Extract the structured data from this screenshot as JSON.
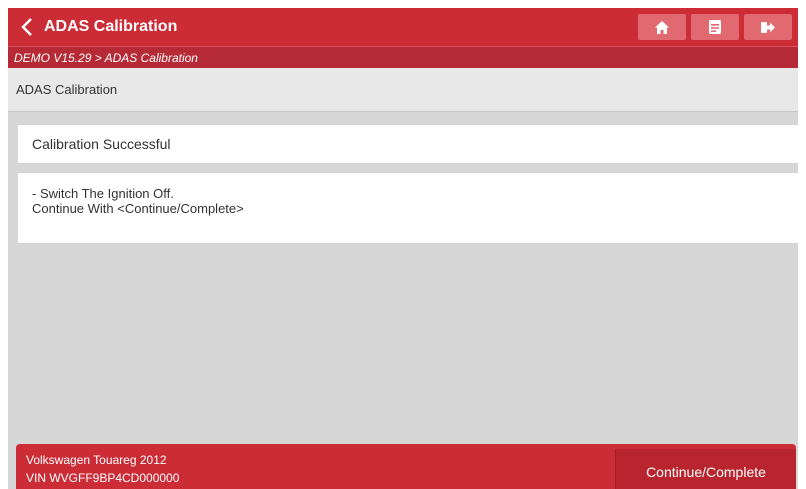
{
  "header": {
    "title": "ADAS Calibration",
    "buttons": [
      {
        "icon": "home-icon"
      },
      {
        "icon": "report-icon"
      },
      {
        "icon": "exit-icon"
      }
    ]
  },
  "breadcrumb": "DEMO V15.29 > ADAS Calibration",
  "subheader": "ADAS Calibration",
  "status": "Calibration Successful",
  "message": {
    "line1": "- Switch The Ignition Off.",
    "line2": "Continue With <Continue/Complete>"
  },
  "footer": {
    "vehicle": "Volkswagen Touareg 2012",
    "vin": "VIN WVGFF9BP4CD000000",
    "continue_label": "Continue/Complete"
  },
  "colors": {
    "primary_red": "#cb2c36",
    "dark_red": "#b52a34",
    "background_gray": "#d6d6d6"
  }
}
